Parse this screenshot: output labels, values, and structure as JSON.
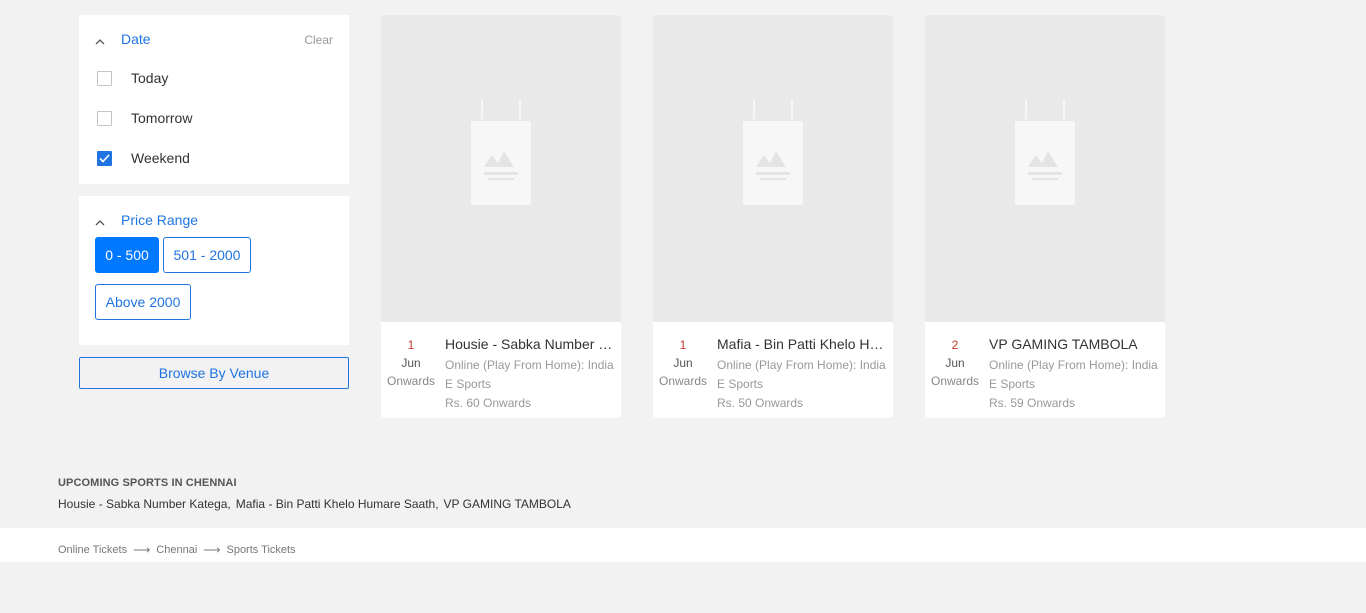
{
  "filters": {
    "date": {
      "title": "Date",
      "clear_label": "Clear",
      "options": [
        {
          "label": "Today",
          "checked": false
        },
        {
          "label": "Tomorrow",
          "checked": false
        },
        {
          "label": "Weekend",
          "checked": true
        }
      ]
    },
    "price": {
      "title": "Price Range",
      "chips": [
        {
          "label": "0 - 500",
          "active": true
        },
        {
          "label": "501 - 2000",
          "active": false
        },
        {
          "label": "Above 2000",
          "active": false
        }
      ]
    },
    "browse_venue_label": "Browse By Venue"
  },
  "events": [
    {
      "day": "1",
      "month": "Jun",
      "onwards": "Onwards",
      "title": "Housie - Sabka Number Kate...",
      "venue": "Online (Play From Home): India",
      "category": "E Sports",
      "price": "Rs. 60 Onwards"
    },
    {
      "day": "1",
      "month": "Jun",
      "onwards": "Onwards",
      "title": "Mafia - Bin Patti Khelo Hum...",
      "venue": "Online (Play From Home): India",
      "category": "E Sports",
      "price": "Rs. 50 Onwards"
    },
    {
      "day": "2",
      "month": "Jun",
      "onwards": "Onwards",
      "title": "VP GAMING TAMBOLA",
      "venue": "Online (Play From Home): India",
      "category": "E Sports",
      "price": "Rs. 59 Onwards"
    }
  ],
  "upcoming": {
    "heading": "UPCOMING SPORTS IN CHENNAI",
    "items": [
      "Housie - Sabka Number Katega,",
      "Mafia - Bin Patti Khelo Humare Saath,",
      "VP GAMING TAMBOLA"
    ]
  },
  "breadcrumb": {
    "items": [
      "Online Tickets",
      "Chennai",
      "Sports Tickets"
    ],
    "separator": "⟶"
  },
  "colors": {
    "accent": "#1f74e2",
    "chip_active": "#0078ff",
    "date_red": "#c0392b",
    "page_bg": "#f2f2f2"
  }
}
